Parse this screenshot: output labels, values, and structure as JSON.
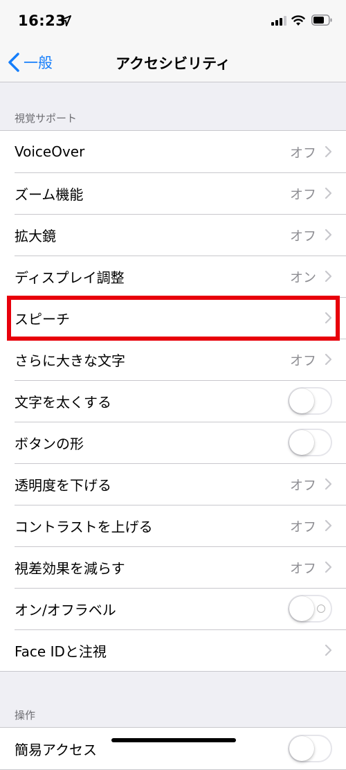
{
  "status_bar": {
    "time": "16:23",
    "location_icon": "location-arrow-icon",
    "signal_icon": "cellular-signal-icon",
    "wifi_icon": "wifi-icon",
    "battery_icon": "battery-icon"
  },
  "nav": {
    "back_label": "一般",
    "title": "アクセシビリティ"
  },
  "colors": {
    "accent": "#157efb",
    "highlight": "#e8000b",
    "background": "#efeff4",
    "secondary_text": "#8e8e93"
  },
  "sections": [
    {
      "header": "視覚サポート",
      "rows": [
        {
          "label": "VoiceOver",
          "value": "オフ",
          "control": "chevron"
        },
        {
          "label": "ズーム機能",
          "value": "オフ",
          "control": "chevron"
        },
        {
          "label": "拡大鏡",
          "value": "オフ",
          "control": "chevron"
        },
        {
          "label": "ディスプレイ調整",
          "value": "オン",
          "control": "chevron"
        },
        {
          "label": "スピーチ",
          "value": "",
          "control": "chevron",
          "highlighted": true
        },
        {
          "label": "さらに大きな文字",
          "value": "オフ",
          "control": "chevron"
        },
        {
          "label": "文字を太くする",
          "value": "",
          "control": "toggle",
          "on": false
        },
        {
          "label": "ボタンの形",
          "value": "",
          "control": "toggle",
          "on": false
        },
        {
          "label": "透明度を下げる",
          "value": "オフ",
          "control": "chevron"
        },
        {
          "label": "コントラストを上げる",
          "value": "オフ",
          "control": "chevron"
        },
        {
          "label": "視差効果を減らす",
          "value": "オフ",
          "control": "chevron"
        },
        {
          "label": "オン/オフラベル",
          "value": "",
          "control": "toggle",
          "on": false,
          "off_label_mark": true
        },
        {
          "label": "Face IDと注視",
          "value": "",
          "control": "chevron"
        }
      ]
    },
    {
      "header": "操作",
      "rows": [
        {
          "label": "簡易アクセス",
          "value": "",
          "control": "toggle",
          "on": false
        }
      ]
    }
  ]
}
